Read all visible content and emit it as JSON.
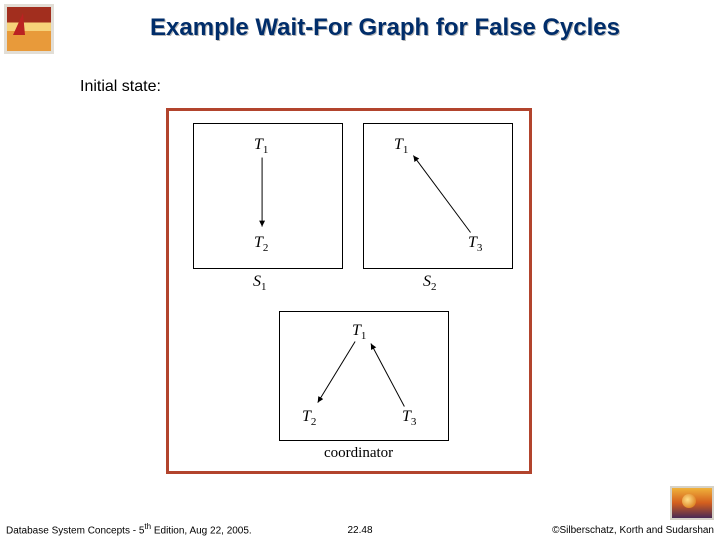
{
  "title": "Example Wait-For Graph for False Cycles",
  "subtitle": "Initial state:",
  "labels": {
    "s1": {
      "base": "S",
      "sub": "1"
    },
    "s2": {
      "base": "S",
      "sub": "2"
    },
    "coord": "coordinator"
  },
  "nodes": {
    "T1": {
      "base": "T",
      "sub": "1"
    },
    "T2": {
      "base": "T",
      "sub": "2"
    },
    "T3": {
      "base": "T",
      "sub": "3"
    }
  },
  "chart_data": [
    {
      "type": "table",
      "name": "S1",
      "nodes": [
        "T1",
        "T2"
      ],
      "edges": [
        [
          "T1",
          "T2"
        ]
      ]
    },
    {
      "type": "table",
      "name": "S2",
      "nodes": [
        "T1",
        "T3"
      ],
      "edges": [
        [
          "T3",
          "T1"
        ]
      ]
    },
    {
      "type": "table",
      "name": "coordinator",
      "nodes": [
        "T1",
        "T2",
        "T3"
      ],
      "edges": [
        [
          "T1",
          "T2"
        ],
        [
          "T3",
          "T1"
        ]
      ]
    }
  ],
  "footer": {
    "left_a": "Database System Concepts - 5",
    "left_b": " Edition, Aug 22, 2005.",
    "left_sup": "th",
    "center": "22.48",
    "right": "©Silberschatz, Korth and Sudarshan"
  }
}
